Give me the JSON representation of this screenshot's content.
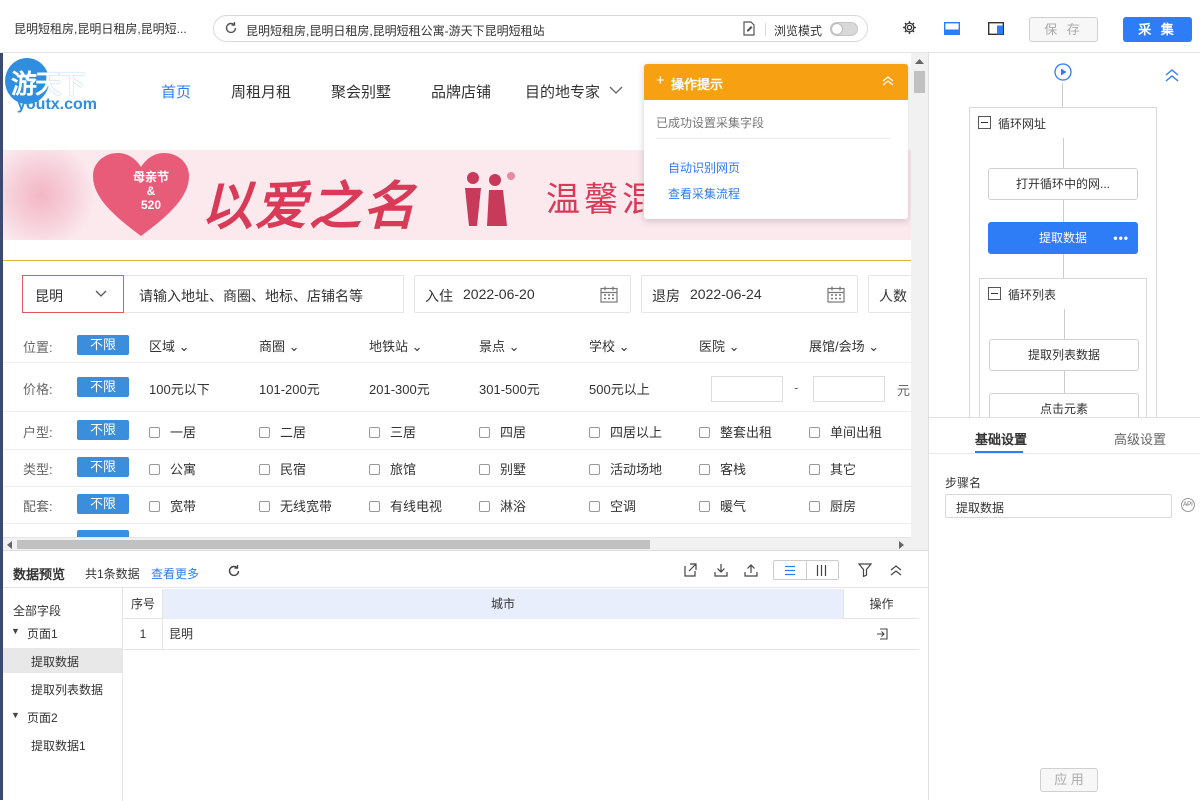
{
  "browser": {
    "tab_title": "昆明短租房,昆明日租房,昆明短...",
    "url": "昆明短租房,昆明日租房,昆明短租公寓-游天下昆明短租站",
    "browse_mode_label": "浏览模式",
    "save_label": "保 存",
    "collect_label": "采 集"
  },
  "site": {
    "logo_cn": "游天下",
    "logo_en": "youtx.com",
    "nav": [
      "首页",
      "周租月租",
      "聚会别墅",
      "品牌店铺",
      "目的地专家"
    ],
    "banner_badge": [
      "母亲节",
      "&",
      "520"
    ],
    "banner_slogan": "以爱之名",
    "banner_text": "温馨混",
    "search": {
      "city": "昆明",
      "keyword_placeholder": "请输入地址、商圈、地标、店铺名等",
      "checkin_label": "入住",
      "checkin_date": "2022-06-20",
      "checkout_label": "退房",
      "checkout_date": "2022-06-24",
      "guests_label": "人数"
    },
    "filters": {
      "no_limit": "不限",
      "location": {
        "label": "位置:",
        "items": [
          "区域",
          "商圈",
          "地铁站",
          "景点",
          "学校",
          "医院",
          "展馆/会场"
        ]
      },
      "price": {
        "label": "价格:",
        "items": [
          "100元以下",
          "101-200元",
          "201-300元",
          "301-500元",
          "500元以上"
        ],
        "range_sep": "-",
        "unit": "元"
      },
      "layout": {
        "label": "户型:",
        "items": [
          "一居",
          "二居",
          "三居",
          "四居",
          "四居以上",
          "整套出租",
          "单间出租"
        ]
      },
      "type": {
        "label": "类型:",
        "items": [
          "公寓",
          "民宿",
          "旅馆",
          "别墅",
          "活动场地",
          "客栈",
          "其它"
        ]
      },
      "amenities": {
        "label": "配套:",
        "items": [
          "宽带",
          "无线宽带",
          "有线电视",
          "淋浴",
          "空调",
          "暖气",
          "厨房"
        ]
      }
    }
  },
  "tip": {
    "title": "操作提示",
    "status": "已成功设置采集字段",
    "links": [
      "自动识别网页",
      "查看采集流程"
    ]
  },
  "preview": {
    "title": "数据预览",
    "count": "共1条数据",
    "more": "查看更多",
    "tree_root": "全部字段",
    "tree": [
      {
        "label": "页面1",
        "children": [
          "提取数据",
          "提取列表数据"
        ]
      },
      {
        "label": "页面2",
        "children": [
          "提取数据1"
        ]
      }
    ],
    "columns": {
      "index": "序号",
      "city": "城市",
      "action": "操作"
    },
    "rows": [
      {
        "index": "1",
        "city": "昆明"
      }
    ]
  },
  "workflow": {
    "loop_url": "循环网址",
    "open_loop_page": "打开循环中的网...",
    "extract_data": "提取数据",
    "loop_list": "循环列表",
    "extract_list": "提取列表数据",
    "click_element": "点击元素",
    "tabs": [
      "基础设置",
      "高级设置"
    ],
    "step_name_label": "步骤名",
    "step_name_value": "提取数据",
    "apply_label": "应 用"
  }
}
